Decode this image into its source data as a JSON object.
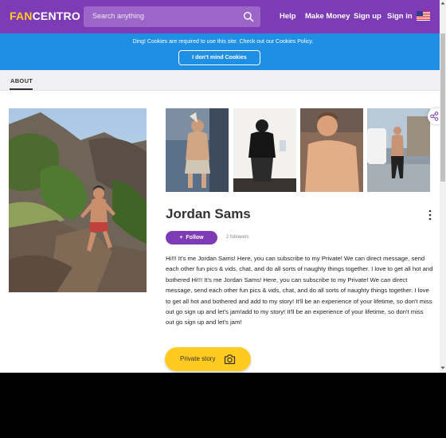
{
  "header": {
    "logo_fan": "FAN",
    "logo_centro": "CENTRO",
    "search_placeholder": "Search anything",
    "nav": [
      "Help",
      "Make Money",
      "Sign up",
      "Sign in"
    ]
  },
  "cookie": {
    "message": "Ding! Cookies are required to use this site. Check out our Cookies Policy.",
    "button": "I don't mind Cookies"
  },
  "tabs": {
    "about": "ABOUT"
  },
  "profile": {
    "name": "Jordan Sams",
    "follow_label": "Follow",
    "followers": "2 followers",
    "bio": "Hi!!! It's me Jordan Sams! Here, you can subscribe to my Private! We can direct message, send each other fun pics & vids, chat, and do all sorts of naughty things together. I love to get all hot and bothered Hi!!! It's me Jordan Sams! Here, you can subscribe to my Private! We can direct message, send each other fun pics & vids, chat, and do all sorts of naughty things together. I love to get all hot and bothered and add to my story! It'll be an experience of your lifetime, so don't miss out go sign up and let's jam!add to my story! It'll be an experience of your lifetime, so don't miss out go sign up and let's jam!",
    "private_story": "Private story"
  },
  "colors": {
    "header": "#7e3bb6",
    "cookie_bar": "#1f8fe6",
    "accent_yellow": "#ffcb21"
  },
  "icons": [
    "search-icon",
    "us-flag-icon",
    "share-icon",
    "kebab-menu-icon",
    "plus-icon",
    "camera-icon"
  ]
}
